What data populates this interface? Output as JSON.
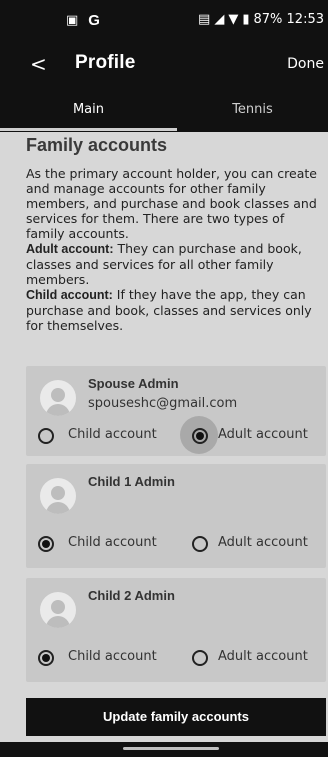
{
  "status_bar": {
    "carrier_icon": "card-icon",
    "g_icon": "G",
    "right_text": "87% 12:53",
    "signal_icons": "nfc signal wifi battery"
  },
  "header": {
    "back_icon": "<",
    "title": "Profile",
    "done": "Done"
  },
  "tabs": [
    {
      "label": "Main",
      "active": true
    },
    {
      "label": "Tennis",
      "active": false
    }
  ],
  "family": {
    "title": "Family accounts",
    "intro": "As the primary account holder, you can create and manage accounts for other family members, and purchase and book classes and services for them. There are two types of family accounts.",
    "adult_label": "Adult account:",
    "adult_text": " They can purchase and book, classes and services for all other family members.",
    "child_label": "Child account:",
    "child_text": " If they have the app, they can purchase and book, classes and services only for themselves."
  },
  "members": [
    {
      "name": "Spouse Admin",
      "email": "spouseshc@gmail.com",
      "child_label": "Child account",
      "adult_label": "Adult account",
      "selected": "adult"
    },
    {
      "name": "Child 1 Admin",
      "email": "",
      "child_label": "Child account",
      "adult_label": "Adult account",
      "selected": "child"
    },
    {
      "name": "Child 2 Admin",
      "email": "",
      "child_label": "Child account",
      "adult_label": "Adult account",
      "selected": "child"
    }
  ],
  "update_button": "Update family accounts",
  "colors": {
    "bar": "#111111",
    "card": "#c8c8c8",
    "background": "#d7d7d7"
  }
}
